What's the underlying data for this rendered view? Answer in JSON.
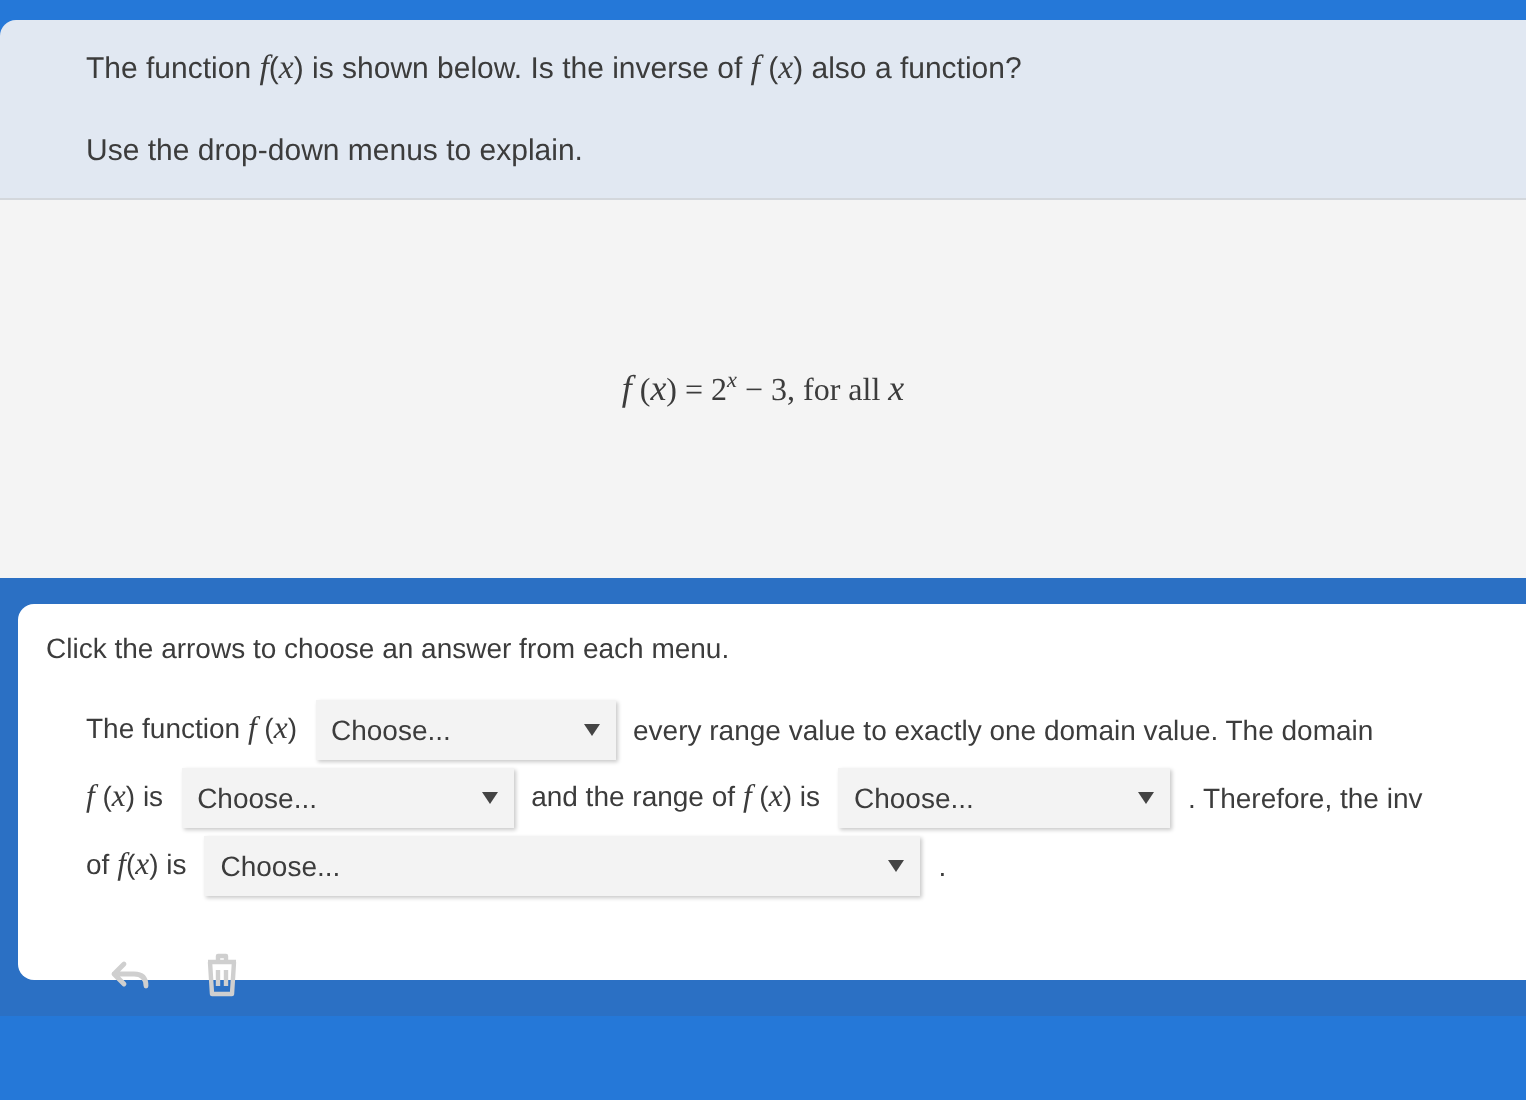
{
  "question": {
    "lines": [
      "The function *f*(*x*) is shown below. Is the inverse of *f* (*x*) also a function?",
      "Use the drop-down menus to explain."
    ]
  },
  "formula": "*f* (*x*) = 2$^{x}$ − 3, for all *x*",
  "answer": {
    "instruction": "Click the arrows to choose an answer from each menu.",
    "rows": [
      [
        {
          "kind": "text",
          "text": "The function *f* (*x*)"
        },
        {
          "kind": "dropdown",
          "value": "Choose..."
        },
        {
          "kind": "text",
          "text": "every range value to exactly one domain value. The domain"
        }
      ],
      [
        {
          "kind": "text",
          "text": "*f* (*x*) is"
        },
        {
          "kind": "dropdown",
          "value": "Choose..."
        },
        {
          "kind": "text",
          "text": "and the range of *f* (*x*) is"
        },
        {
          "kind": "dropdown",
          "value": "Choose..."
        },
        {
          "kind": "text",
          "text": ". Therefore, the inv"
        }
      ],
      [
        {
          "kind": "text",
          "text": "of *f*(*x*) is"
        },
        {
          "kind": "dropdown",
          "value": "Choose..."
        },
        {
          "kind": "text",
          "text": "."
        }
      ]
    ],
    "tools": [
      {
        "kind": "undo",
        "disabled": true
      },
      {
        "kind": "delete",
        "disabled": true
      }
    ]
  }
}
